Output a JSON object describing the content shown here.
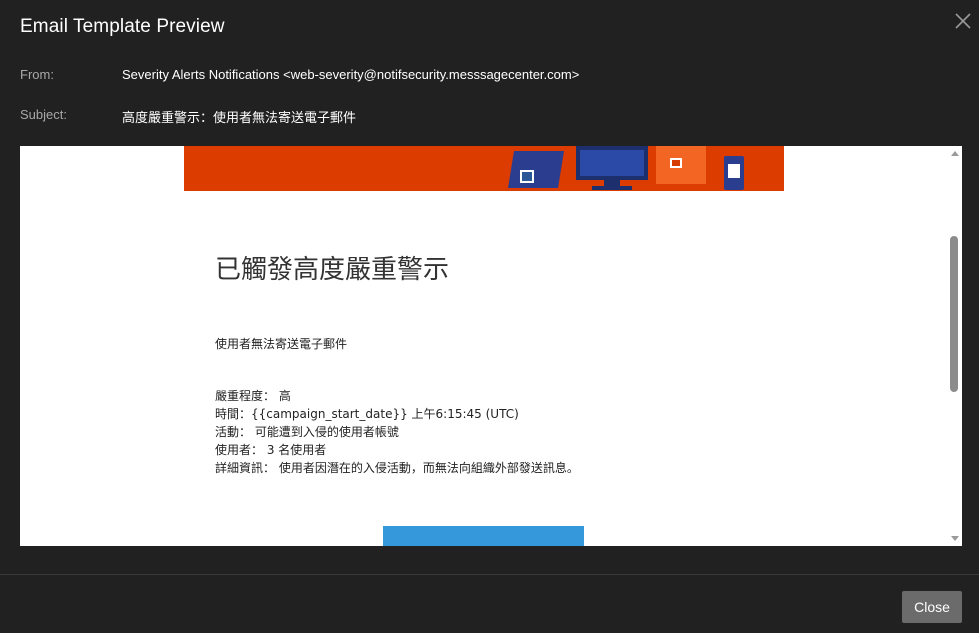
{
  "dialog": {
    "title": "Email Template Preview",
    "close_icon": "close-x-icon"
  },
  "meta": {
    "from_label": "From:",
    "from_value": "Severity Alerts Notifications <web-severity@notifsecurity.messsagecenter.com>",
    "subject_label": "Subject:",
    "subject_value": "高度嚴重警示：使用者無法寄送電子郵件"
  },
  "email": {
    "banner_color": "#dc3c00",
    "heading": "已觸發高度嚴重警示",
    "summary": "使用者無法寄送電子郵件",
    "details": [
      "嚴重程度： 高",
      "時間：{{campaign_start_date}} 上午6:15:45 (UTC)",
      "活動： 可能遭到入侵的使用者帳號",
      "使用者： 3 名使用者",
      "詳細資訊： 使用者因潛在的入侵活動，而無法向組織外部發送訊息。"
    ],
    "cta_color": "#3498db"
  },
  "footer": {
    "close_label": "Close"
  }
}
